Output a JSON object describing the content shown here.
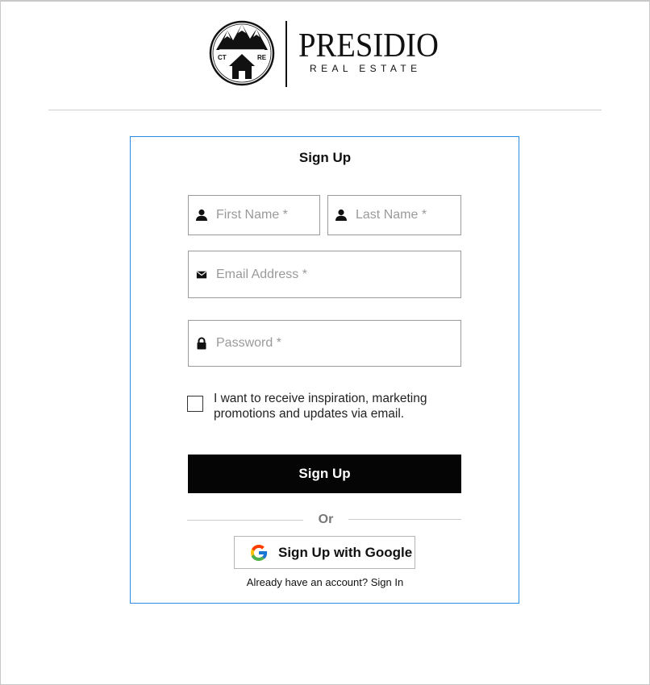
{
  "brand": {
    "name": "PRESIDIO",
    "tagline": "REAL ESTATE",
    "emblem_left_text": "CT",
    "emblem_right_text": "RE"
  },
  "form": {
    "title": "Sign Up",
    "first_name_placeholder": "First Name *",
    "last_name_placeholder": "Last Name *",
    "email_placeholder": "Email Address *",
    "password_placeholder": "Password *",
    "consent_label": "I want to receive inspiration, marketing promotions and updates via email.",
    "submit_label": "Sign Up",
    "divider_label": "Or",
    "google_label": "Sign Up with Google",
    "signin_prompt": "Already have an account?",
    "signin_link": "Sign In"
  },
  "icons": {
    "first_name": "person-icon",
    "last_name": "person-icon",
    "email": "envelope-icon",
    "password": "lock-icon",
    "google": "google-g-icon"
  },
  "colors": {
    "card_border": "#2b8be6",
    "primary_button": "#050505",
    "placeholder": "#9a9a9a"
  }
}
